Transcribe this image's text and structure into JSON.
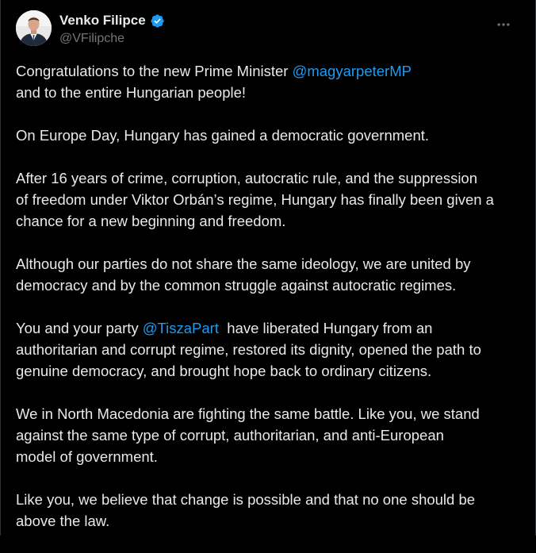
{
  "author": {
    "display_name": "Venko Filipce",
    "handle": "@VFilipche",
    "verified_badge_color": "#1d9bf0",
    "avatar_icon": "profile-photo"
  },
  "menu": {
    "icon": "more-horizontal-icon"
  },
  "post": {
    "p1": {
      "pre": "Congratulations to the new Prime Minister ",
      "mention": "@magyarpeterMP",
      "line2": "and to the entire Hungarian people!"
    },
    "p2": "On Europe Day, Hungary has gained a democratic government.",
    "p3": {
      "l1": "After 16 years of crime, corruption, autocratic rule, and the suppression",
      "l2": "of freedom under Viktor Orbán’s regime, Hungary has finally been given a",
      "l3": "chance for a new beginning and freedom."
    },
    "p4": {
      "l1": "Although our parties do not share the same ideology, we are united by",
      "l2": "democracy and by the common struggle against autocratic regimes."
    },
    "p5": {
      "pre": "You and your party ",
      "mention": "@TiszaPart",
      "post": "  have liberated Hungary from an",
      "l2": "authoritarian and corrupt regime, restored its dignity, opened the path to",
      "l3": "genuine democracy, and brought hope back to ordinary citizens."
    },
    "p6": {
      "l1": "We in North Macedonia are fighting the same battle. Like you, we stand",
      "l2": "against the same type of corrupt, authoritarian, and anti-European",
      "l3": "model of government."
    },
    "p7": {
      "l1": "Like you, we believe that change is possible and that no one should be",
      "l2": "above the law."
    }
  },
  "colors": {
    "background": "#000000",
    "text": "#e7e9ea",
    "secondary": "#71767b",
    "link": "#1d9bf0"
  }
}
